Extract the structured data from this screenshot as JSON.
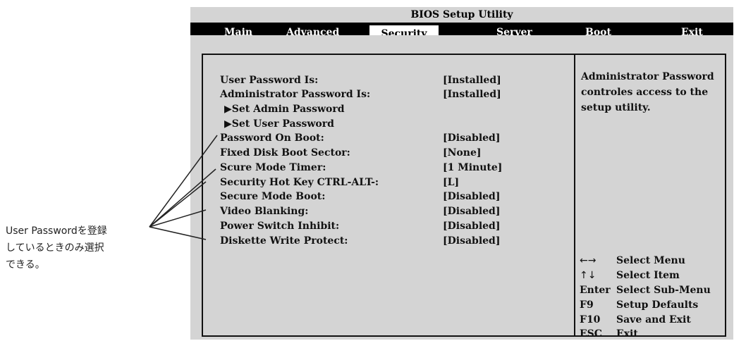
{
  "window": {
    "title": "BIOS Setup Utility"
  },
  "tabs": [
    {
      "label": "Main",
      "active": false
    },
    {
      "label": "Advanced",
      "active": false
    },
    {
      "label": "Security",
      "active": true
    },
    {
      "label": "Server",
      "active": false
    },
    {
      "label": "Boot",
      "active": false
    },
    {
      "label": "Exit",
      "active": false
    }
  ],
  "settings": [
    {
      "label": "User Password Is:",
      "value": "[Installed]"
    },
    {
      "label": "Administrator Password Is:",
      "value": "[Installed]"
    },
    {
      "label": "▶Set Admin Password",
      "value": ""
    },
    {
      "label": "▶Set User Password",
      "value": ""
    },
    {
      "label": "Password On Boot:",
      "value": "[Disabled]"
    },
    {
      "label": "Fixed Disk Boot Sector:",
      "value": "[None]"
    },
    {
      "label": "Scure Mode Timer:",
      "value": "[1 Minute]"
    },
    {
      "label": "Security Hot Key CTRL-ALT-:",
      "value": "[L]"
    },
    {
      "label": "Secure Mode Boot:",
      "value": "[Disabled]"
    },
    {
      "label": "Video Blanking:",
      "value": "[Disabled]"
    },
    {
      "label": "Power Switch Inhibit:",
      "value": "[Disabled]"
    },
    {
      "label": "Diskette Write Protect:",
      "value": "[Disabled]"
    }
  ],
  "help": {
    "text": "Administrator Password controles access to the setup utility.",
    "keys": [
      {
        "key": "←→",
        "desc": "Select Menu"
      },
      {
        "key": "↑↓",
        "desc": "Select Item"
      },
      {
        "key": "Enter",
        "desc": "Select Sub-Menu"
      },
      {
        "key": "F9",
        "desc": "Setup Defaults"
      },
      {
        "key": "F10",
        "desc": "Save and Exit"
      },
      {
        "key": "ESC",
        "desc": "Exit"
      }
    ]
  },
  "callout": {
    "lines": [
      "User Passwordを登録",
      "しているときのみ選択",
      "できる。"
    ]
  },
  "colors": {
    "panel_bg": "#d4d4d4",
    "tab_bar": "#000000",
    "text": "#111111"
  }
}
